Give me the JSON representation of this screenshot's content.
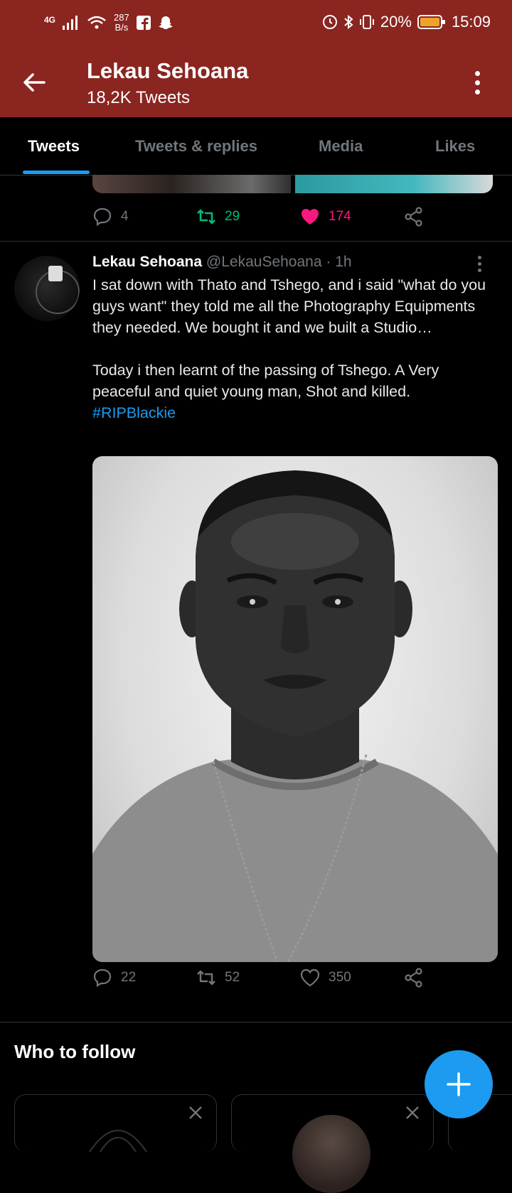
{
  "status_bar": {
    "network": "4G",
    "speed_value": "287",
    "speed_unit": "B/s",
    "battery": "20%",
    "time": "15:09"
  },
  "header": {
    "title": "Lekau Sehoana",
    "subtitle": "18,2K Tweets"
  },
  "tabs": [
    {
      "label": "Tweets",
      "active": true
    },
    {
      "label": "Tweets & replies",
      "active": false
    },
    {
      "label": "Media",
      "active": false
    },
    {
      "label": "Likes",
      "active": false
    }
  ],
  "prev_tweet": {
    "replies": "4",
    "retweets": "29",
    "likes": "174"
  },
  "tweet": {
    "name": "Lekau Sehoana",
    "handle": "@LekauSehoana",
    "time": "1h",
    "para1": "I sat down with Thato and Tshego, and i said \"what do you guys want\" they told me all the Photography Equipments they needed. We bought it and we built a Studio…",
    "para2": "Today i then learnt of the passing of Tshego. A Very peaceful and quiet young man, Shot and killed.",
    "hashtag": "#RIPBlackie",
    "replies": "22",
    "retweets": "52",
    "likes": "350"
  },
  "who_to_follow": {
    "title": "Who to follow"
  },
  "colors": {
    "header_bg": "#8b2520",
    "accent": "#1d9bf0",
    "retweet_active": "#00ba7c",
    "like_active": "#f91880"
  }
}
